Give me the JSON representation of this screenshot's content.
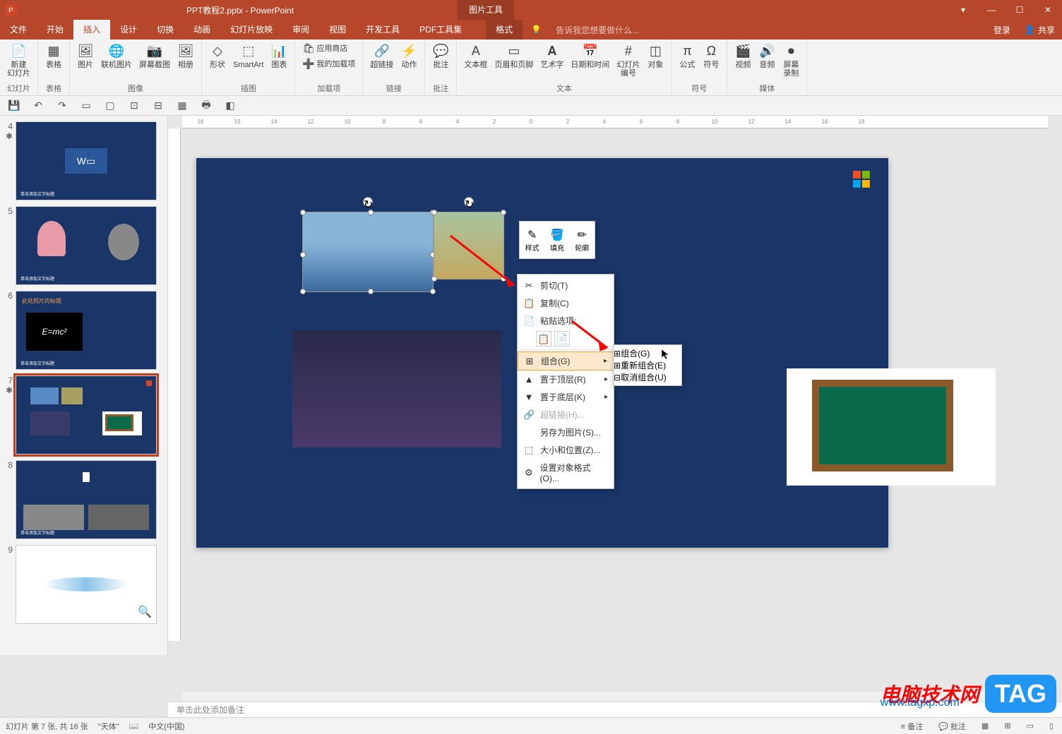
{
  "title": "PPT教程2.pptx - PowerPoint",
  "picture_tools": "图片工具",
  "format_tab": "格式",
  "tellme": "告诉我您想要做什么...",
  "login": "登录",
  "share": "共享",
  "tabs": [
    "文件",
    "开始",
    "插入",
    "设计",
    "切换",
    "动画",
    "幻灯片放映",
    "审阅",
    "视图",
    "开发工具",
    "PDF工具集"
  ],
  "active_tab_index": 2,
  "ribbon": {
    "groups": [
      {
        "label": "幻灯片",
        "items": [
          {
            "label": "新建\n幻灯片",
            "icon": "📄"
          }
        ]
      },
      {
        "label": "表格",
        "items": [
          {
            "label": "表格",
            "icon": "▦"
          }
        ]
      },
      {
        "label": "图像",
        "items": [
          {
            "label": "图片",
            "icon": "🖼"
          },
          {
            "label": "联机图片",
            "icon": "🌐"
          },
          {
            "label": "屏幕截图",
            "icon": "📷"
          },
          {
            "label": "相册",
            "icon": "🖼"
          }
        ]
      },
      {
        "label": "插图",
        "items": [
          {
            "label": "形状",
            "icon": "◇"
          },
          {
            "label": "SmartArt",
            "icon": "⬚"
          },
          {
            "label": "图表",
            "icon": "📊"
          }
        ]
      },
      {
        "label": "加载项",
        "stack": [
          {
            "label": "应用商店",
            "icon": "🛍"
          },
          {
            "label": "我的加载项",
            "icon": "➕"
          }
        ]
      },
      {
        "label": "链接",
        "items": [
          {
            "label": "超链接",
            "icon": "🔗"
          },
          {
            "label": "动作",
            "icon": "⚡"
          }
        ]
      },
      {
        "label": "批注",
        "items": [
          {
            "label": "批注",
            "icon": "💬"
          }
        ]
      },
      {
        "label": "文本",
        "items": [
          {
            "label": "文本框",
            "icon": "A"
          },
          {
            "label": "页眉和页脚",
            "icon": "▭"
          },
          {
            "label": "艺术字",
            "icon": "𝐀"
          },
          {
            "label": "日期和时间",
            "icon": "📅"
          },
          {
            "label": "幻灯片\n编号",
            "icon": "#"
          },
          {
            "label": "对象",
            "icon": "◫"
          }
        ]
      },
      {
        "label": "符号",
        "items": [
          {
            "label": "公式",
            "icon": "π"
          },
          {
            "label": "符号",
            "icon": "Ω"
          }
        ]
      },
      {
        "label": "媒体",
        "items": [
          {
            "label": "视频",
            "icon": "🎬"
          },
          {
            "label": "音频",
            "icon": "🔊"
          },
          {
            "label": "屏幕\n录制",
            "icon": "⏺"
          }
        ]
      }
    ]
  },
  "mini_toolbar": [
    {
      "label": "样式",
      "icon": "✎"
    },
    {
      "label": "填充",
      "icon": "🪣"
    },
    {
      "label": "轮廓",
      "icon": "✏"
    }
  ],
  "context_menu": [
    {
      "label": "剪切(T)",
      "icon": "✂"
    },
    {
      "label": "复制(C)",
      "icon": "📋"
    },
    {
      "label": "粘贴选项:",
      "icon": "📄",
      "paste": true
    },
    {
      "label": "组合(G)",
      "icon": "⊞",
      "arrow": true,
      "highlight": true
    },
    {
      "label": "置于顶层(R)",
      "icon": "▲",
      "arrow": true
    },
    {
      "label": "置于底层(K)",
      "icon": "▼",
      "arrow": true
    },
    {
      "label": "超链接(H)...",
      "icon": "🔗",
      "disabled": true
    },
    {
      "label": "另存为图片(S)...",
      "icon": ""
    },
    {
      "label": "大小和位置(Z)...",
      "icon": "⬚"
    },
    {
      "label": "设置对象格式(O)...",
      "icon": "⚙"
    }
  ],
  "submenu": [
    {
      "label": "组合(G)",
      "icon": "⊞",
      "highlight": true
    },
    {
      "label": "重新组合(E)",
      "icon": "⊞",
      "disabled": true
    },
    {
      "label": "取消组合(U)",
      "icon": "⊟",
      "disabled": true
    }
  ],
  "thumbs": [
    {
      "num": "4",
      "star": true
    },
    {
      "num": "5"
    },
    {
      "num": "6"
    },
    {
      "num": "7",
      "star": true,
      "selected": true
    },
    {
      "num": "8"
    },
    {
      "num": "9"
    }
  ],
  "slide_title_6": "此处照片的标题",
  "notes_placeholder": "单击此处添加备注",
  "status": {
    "slide": "幻灯片 第 7 张, 共 16 张",
    "theme": "\"天体\"",
    "lang": "中文(中国)",
    "notes": "备注",
    "comments": "批注"
  },
  "ruler_marks": [
    "18",
    "16",
    "14",
    "12",
    "10",
    "8",
    "6",
    "4",
    "2",
    "0",
    "2",
    "4",
    "6",
    "8",
    "10",
    "12",
    "14",
    "16",
    "18"
  ],
  "watermark": {
    "text": "电脑技术网",
    "url": "www.tagxp.com",
    "tag": "TAG"
  }
}
